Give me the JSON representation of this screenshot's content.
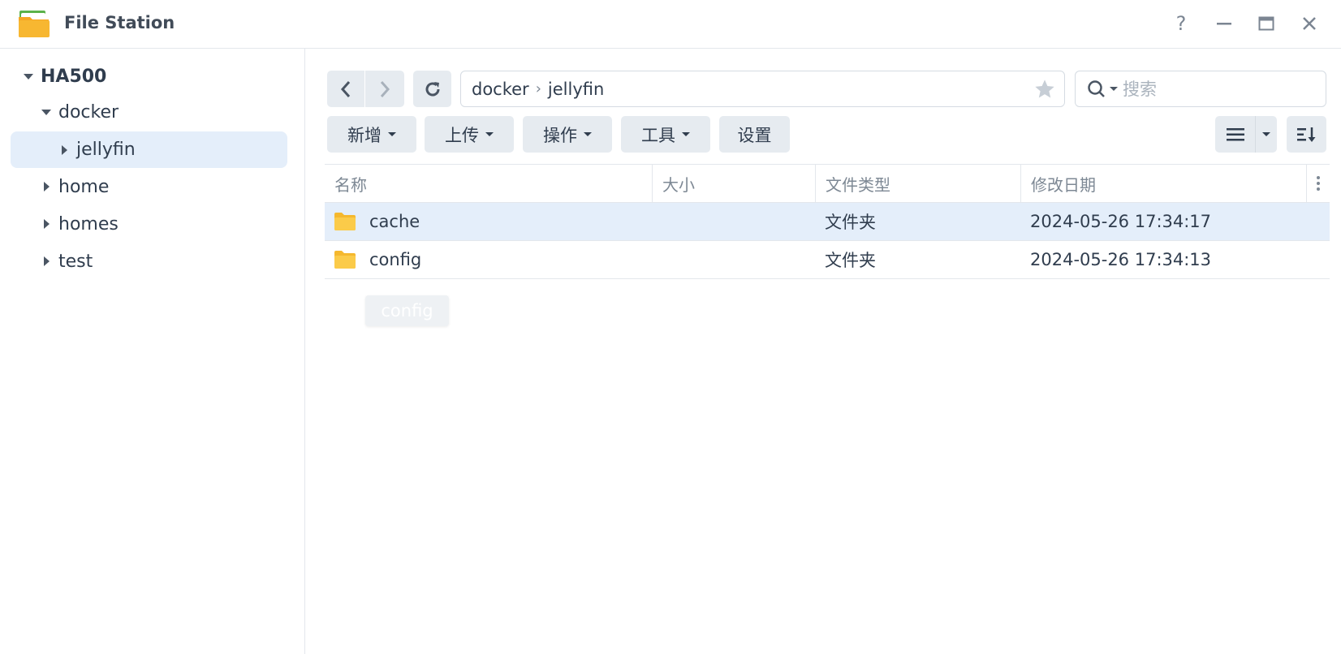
{
  "window": {
    "title": "File Station"
  },
  "colors": {
    "accent_bg": "#e4eefa",
    "button_bg": "#e6ebf0",
    "text": "#303d4e",
    "folder": "#f7c23d"
  },
  "sidebar": {
    "root": "HA500",
    "items": [
      {
        "label": "docker",
        "expanded": true
      },
      {
        "label": "jellyfin",
        "selected": true
      },
      {
        "label": "home"
      },
      {
        "label": "homes"
      },
      {
        "label": "test"
      }
    ]
  },
  "path": {
    "segments": [
      "docker",
      "jellyfin"
    ]
  },
  "search": {
    "placeholder": "搜索"
  },
  "toolbar": {
    "new": "新增",
    "upload": "上传",
    "action": "操作",
    "tools": "工具",
    "settings": "设置"
  },
  "columns": {
    "name": "名称",
    "size": "大小",
    "type": "文件类型",
    "modified": "修改日期"
  },
  "files": [
    {
      "name": "cache",
      "size": "",
      "type": "文件夹",
      "modified": "2024-05-26 17:34:17",
      "selected": true
    },
    {
      "name": "config",
      "size": "",
      "type": "文件夹",
      "modified": "2024-05-26 17:34:13"
    }
  ],
  "drag_label": "config"
}
